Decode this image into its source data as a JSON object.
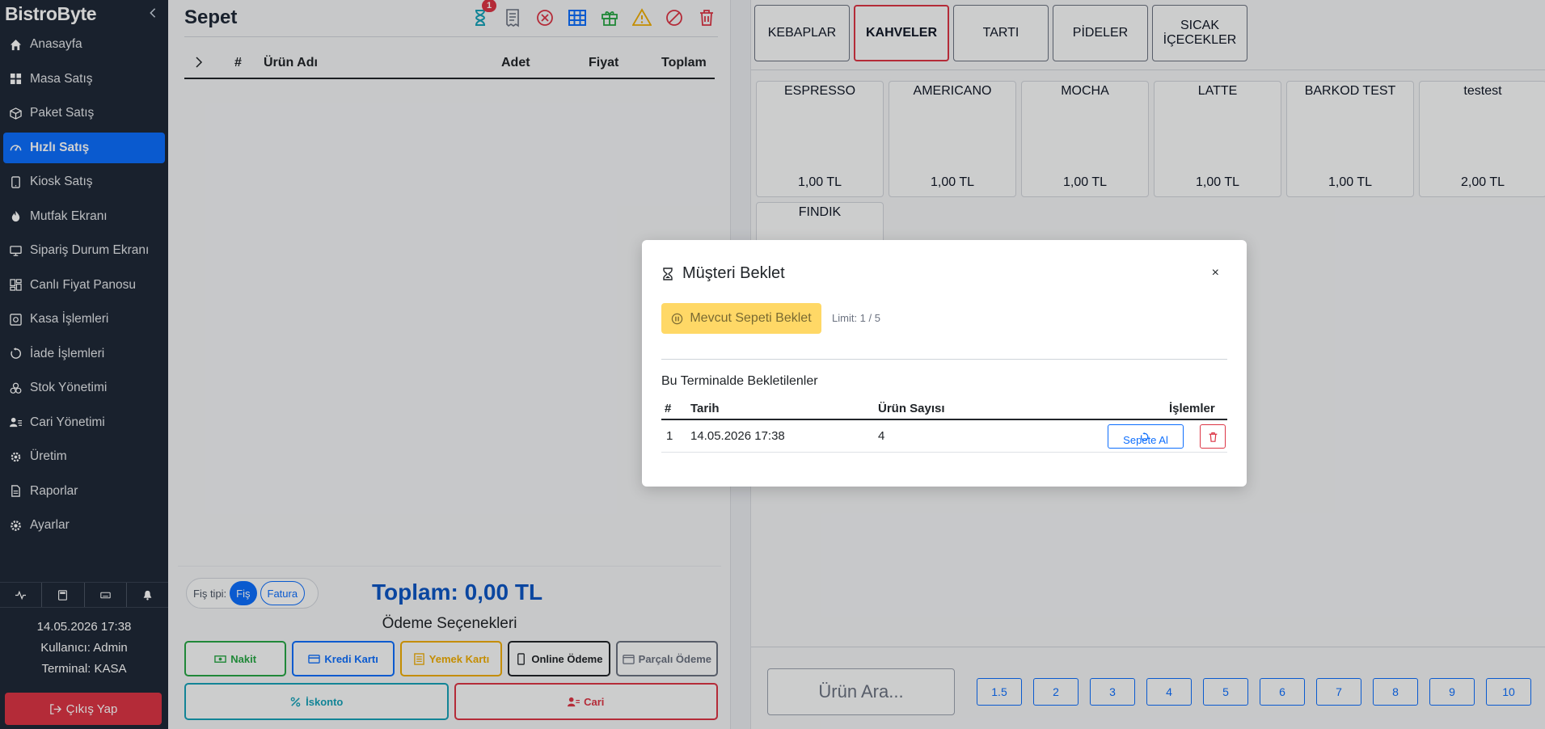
{
  "sidebar": {
    "brand": "BistroByte",
    "items": [
      {
        "label": "Anasayfa",
        "icon": "home-icon"
      },
      {
        "label": "Masa Satış",
        "icon": "grid-icon"
      },
      {
        "label": "Paket Satış",
        "icon": "box-icon"
      },
      {
        "label": "Hızlı Satış",
        "icon": "speedometer-icon",
        "active": true
      },
      {
        "label": "Kiosk Satış",
        "icon": "tablet-icon"
      },
      {
        "label": "Mutfak Ekranı",
        "icon": "fire-icon"
      },
      {
        "label": "Sipariş Durum Ekranı",
        "icon": "monitor-icon"
      },
      {
        "label": "Canlı Fiyat Panosu",
        "icon": "dashboard-icon"
      },
      {
        "label": "Kasa İşlemleri",
        "icon": "safe-icon"
      },
      {
        "label": "İade İşlemleri",
        "icon": "refresh-icon"
      },
      {
        "label": "Stok Yönetimi",
        "icon": "boxes-icon"
      },
      {
        "label": "Cari Yönetimi",
        "icon": "person-card-icon"
      },
      {
        "label": "Üretim",
        "icon": "gear-icon"
      },
      {
        "label": "Raporlar",
        "icon": "report-icon"
      },
      {
        "label": "Ayarlar",
        "icon": "settings-icon"
      }
    ],
    "datetime": "14.05.2026  17:38",
    "user": "Kullanıcı: Admin",
    "terminal": "Terminal: KASA",
    "logout": "Çıkış Yap"
  },
  "cart": {
    "title": "Sepet",
    "hold_count": "1",
    "columns": {
      "num": "#",
      "name": "Ürün Adı",
      "qty": "Adet",
      "price": "Fiyat",
      "total": "Toplam"
    },
    "receipt_type_label": "Fiş tipi:",
    "receipt_fis": "Fiş",
    "receipt_fatura": "Fatura",
    "total": "Toplam: 0,00 TL",
    "payment_title": "Ödeme Seçenekleri",
    "payments": {
      "cash": "Nakit",
      "card": "Kredi Kartı",
      "meal": "Yemek Kartı",
      "online": "Online Ödeme",
      "split": "Parçalı Ödeme",
      "discount": "İskonto",
      "account": "Cari"
    }
  },
  "categories": [
    "KEBAPLAR",
    "KAHVELER",
    "TARTI",
    "PİDELER",
    "SICAK İÇECEKLER"
  ],
  "active_category": "KAHVELER",
  "products": [
    {
      "name": "ESPRESSO",
      "price": "1,00 TL"
    },
    {
      "name": "AMERICANO",
      "price": "1,00 TL"
    },
    {
      "name": "MOCHA",
      "price": "1,00 TL"
    },
    {
      "name": "LATTE",
      "price": "1,00 TL"
    },
    {
      "name": "BARKOD TEST",
      "price": "1,00 TL"
    },
    {
      "name": "testest",
      "price": "2,00 TL"
    },
    {
      "name": "FINDIK",
      "price": ""
    }
  ],
  "search_placeholder": "Ürün Ara...",
  "quantities": [
    "1.5",
    "2",
    "3",
    "4",
    "5",
    "6",
    "7",
    "8",
    "9",
    "10"
  ],
  "modal": {
    "title": "Müşteri Beklet",
    "close": "×",
    "hold_button": "Mevcut Sepeti Beklet",
    "limit": "Limit: 1 / 5",
    "subtitle": "Bu Terminalde Bekletilenler",
    "columns": {
      "num": "#",
      "date": "Tarih",
      "count": "Ürün Sayısı",
      "actions": "İşlemler"
    },
    "rows": [
      {
        "num": "1",
        "date": "14.05.2026 17:38",
        "count": "4",
        "take": "Sepete Al"
      }
    ]
  },
  "colors": {
    "primary": "#0d6efd",
    "danger": "#dc3545",
    "warning": "#ffd866",
    "sidebar": "#1f2937"
  }
}
